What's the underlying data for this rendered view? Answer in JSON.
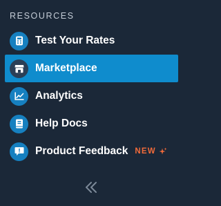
{
  "sidebar": {
    "section_title": "RESOURCES",
    "items": [
      {
        "label": "Test Your Rates",
        "icon": "calculator-icon",
        "active": false
      },
      {
        "label": "Marketplace",
        "icon": "store-icon",
        "active": true
      },
      {
        "label": "Analytics",
        "icon": "chart-line-icon",
        "active": false
      },
      {
        "label": "Help Docs",
        "icon": "book-icon",
        "active": false
      },
      {
        "label": "Product Feedback",
        "icon": "message-icon",
        "active": false,
        "badge": "NEW"
      }
    ],
    "collapse_icon": "double-chevron-left-icon"
  },
  "colors": {
    "background": "#1b2838",
    "active": "#0f8ccd",
    "icon_circle": "#1680c0",
    "badge": "#f26b3a"
  }
}
